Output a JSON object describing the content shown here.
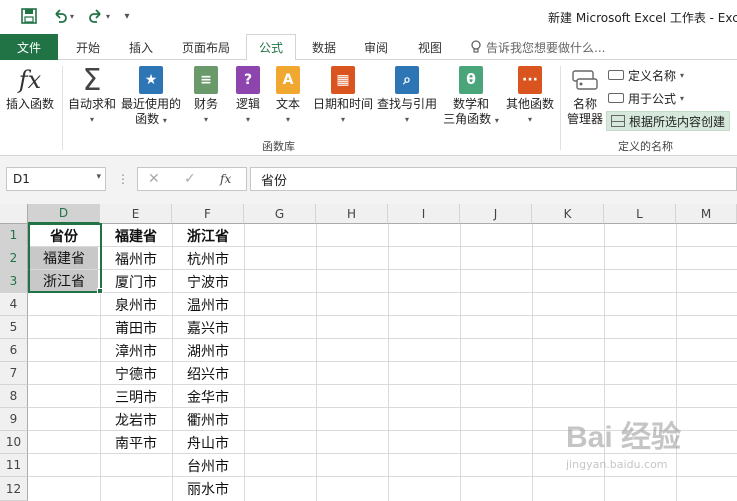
{
  "window": {
    "title": "新建 Microsoft Excel 工作表 - Exc"
  },
  "tabs": [
    {
      "label": "文件"
    },
    {
      "label": "开始"
    },
    {
      "label": "插入"
    },
    {
      "label": "页面布局"
    },
    {
      "label": "公式",
      "active": true
    },
    {
      "label": "数据"
    },
    {
      "label": "审阅"
    },
    {
      "label": "视图"
    }
  ],
  "tell_me": "告诉我您想要做什么...",
  "ribbon": {
    "function_library": {
      "insert_function": "插入函数",
      "autosum": "自动求和",
      "recent_1": "最近使用的",
      "recent_2": "函数",
      "financial": "财务",
      "logical": "逻辑",
      "text": "文本",
      "datetime": "日期和时间",
      "lookup": "查找与引用",
      "math_1": "数学和",
      "math_2": "三角函数",
      "more": "其他函数",
      "group_label": "函数库"
    },
    "defined_names": {
      "name_manager_1": "名称",
      "name_manager_2": "管理器",
      "define_name": "定义名称",
      "use_in_formula": "用于公式",
      "create_from_selection": "根据所选内容创建",
      "group_label": "定义的名称"
    }
  },
  "formula_bar": {
    "name_box": "D1",
    "formula": "省份"
  },
  "columns": [
    "D",
    "E",
    "F",
    "G",
    "H",
    "I",
    "J",
    "K",
    "L",
    "M"
  ],
  "rows": [
    "1",
    "2",
    "3",
    "4",
    "5",
    "6",
    "7",
    "8",
    "9",
    "10",
    "11",
    "12"
  ],
  "cells": {
    "D": [
      "省份",
      "福建省",
      "浙江省"
    ],
    "E": [
      "福建省",
      "福州市",
      "厦门市",
      "泉州市",
      "莆田市",
      "漳州市",
      "宁德市",
      "三明市",
      "龙岩市",
      "南平市"
    ],
    "F": [
      "浙江省",
      "杭州市",
      "宁波市",
      "温州市",
      "嘉兴市",
      "湖州市",
      "绍兴市",
      "金华市",
      "衢州市",
      "舟山市",
      "台州市",
      "丽水市"
    ]
  },
  "watermark": {
    "line1": "Bai 经验",
    "line2": "jingyan.baidu.com"
  },
  "colors": {
    "accent": "#217346",
    "selection_shade": "#c8c8c8"
  }
}
